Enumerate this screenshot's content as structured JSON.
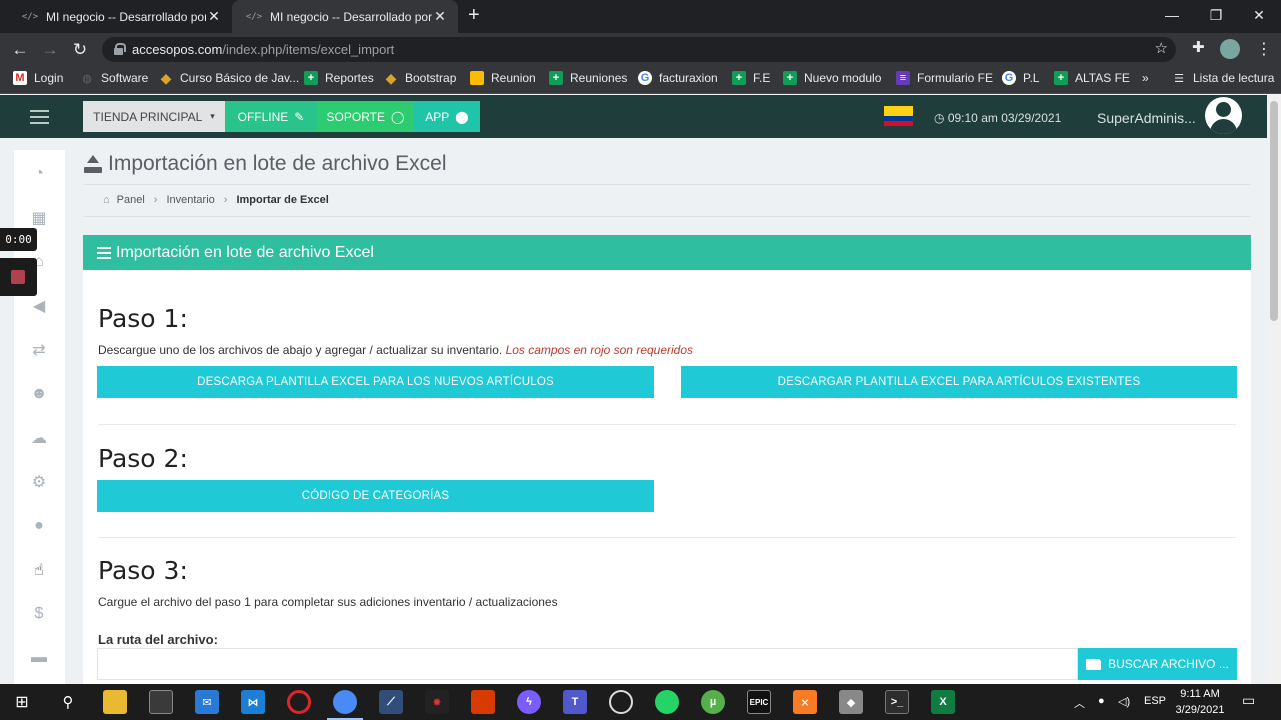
{
  "browser": {
    "tabs": [
      {
        "favicon": "</>",
        "title": "MI negocio -- Desarrollado por S"
      },
      {
        "favicon": "</>",
        "title": "MI negocio -- Desarrollado por S"
      }
    ],
    "url_host": "accesopos.com",
    "url_path": "/index.php/items/excel_import",
    "bookmarks": [
      {
        "label": "Login",
        "icon": "gmail-icon"
      },
      {
        "label": "Software",
        "icon": "generic-icon"
      },
      {
        "label": "Curso Básico de Jav...",
        "icon": "diamond-icon"
      },
      {
        "label": "Reportes",
        "icon": "sheets-icon"
      },
      {
        "label": "Bootstrap",
        "icon": "diamond-icon"
      },
      {
        "label": "Reunion",
        "icon": "meet-icon"
      },
      {
        "label": "Reuniones",
        "icon": "sheets-icon"
      },
      {
        "label": "facturaxion",
        "icon": "google-icon"
      },
      {
        "label": "F.E",
        "icon": "sheets-icon"
      },
      {
        "label": "Nuevo modulo",
        "icon": "sheets-icon"
      },
      {
        "label": "Formulario FE",
        "icon": "forms-icon"
      },
      {
        "label": "P.L",
        "icon": "google-icon"
      },
      {
        "label": "ALTAS FE",
        "icon": "sheets-icon"
      }
    ],
    "more_bookmarks": "»",
    "reading_list": "Lista de lectura"
  },
  "header": {
    "store_button": "TIENDA PRINCIPAL",
    "offline_button": "OFFLINE",
    "support_button": "SOPORTE",
    "app_button": "APP",
    "datetime": "09:10 am 03/29/2021",
    "user": "SuperAdminis..."
  },
  "recorder": {
    "timer": "0:00"
  },
  "page": {
    "title": "Importación en lote de archivo Excel",
    "breadcrumb": [
      "Panel",
      "Inventario",
      "Importar de Excel"
    ],
    "card_title": "Importación en lote de archivo Excel",
    "step1": {
      "title": "Paso 1:",
      "desc": "Descargue uno de los archivos de abajo y agregar / actualizar su inventario.",
      "required_note": "Los campos en rojo son requeridos",
      "btn_new": "DESCARGA PLANTILLA EXCEL PARA LOS NUEVOS ARTÍCULOS",
      "btn_existing": "DESCARGAR PLANTILLA EXCEL PARA ARTÍCULOS EXISTENTES"
    },
    "step2": {
      "title": "Paso 2:",
      "btn_categories": "CÓDIGO DE CATEGORÍAS"
    },
    "step3": {
      "title": "Paso 3:",
      "desc": "Cargue el archivo del paso 1 para completar sus adiciones inventario / actualizaciones",
      "file_label": "La ruta del archivo:",
      "file_value": "",
      "browse_button": "BUSCAR ARCHIVO ..."
    }
  },
  "taskbar": {
    "lang": "ESP",
    "time": "9:11 AM",
    "date": "3/29/2021"
  },
  "colors": {
    "header_bg": "#1f3d3a",
    "card_header": "#2fbfa0",
    "action_button": "#1fc9d6",
    "required_text": "#c0392b"
  }
}
